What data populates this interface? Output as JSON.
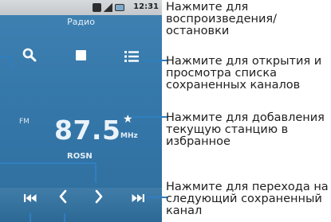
{
  "statusbar": {
    "time": "12:31"
  },
  "app": {
    "title": "Радио"
  },
  "toolbar": {
    "search_icon": "search-icon",
    "play_pause_icon": "stop-square-icon",
    "list_icon": "list-icon"
  },
  "tuner": {
    "band": "FM",
    "frequency": "87.5",
    "unit": "MHz",
    "station": "ROSN",
    "favorite_icon": "star-icon"
  },
  "controls": {
    "prev_icon": "skip-back-icon",
    "left_icon": "chevron-left-icon",
    "right_icon": "chevron-right-icon",
    "next_icon": "skip-forward-icon"
  },
  "callouts": {
    "play": "Нажмите для воспроизведения/остановки",
    "list": "Нажмите для открытия и просмотра списка сохраненных каналов",
    "favorite": "Нажмите для добавления текущую станцию в избранное",
    "next": "Нажмите для перехода на следующий сохраненный канал"
  },
  "colors": {
    "screen_top": "#3f82b2",
    "screen_bottom": "#2f6f9e",
    "callout_line": "#2f7fc0"
  }
}
